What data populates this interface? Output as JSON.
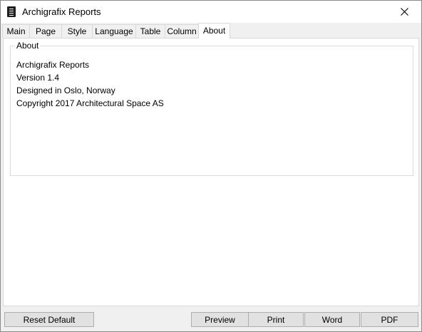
{
  "window": {
    "title": "Archigrafix Reports",
    "app_icon": "document-icon",
    "close_icon": "close-icon"
  },
  "tabs": [
    {
      "label": "Main",
      "active": false
    },
    {
      "label": "Page",
      "active": false
    },
    {
      "label": "Style",
      "active": false
    },
    {
      "label": "Language",
      "active": false
    },
    {
      "label": "Table",
      "active": false
    },
    {
      "label": "Column",
      "active": false
    },
    {
      "label": "About",
      "active": true
    }
  ],
  "about": {
    "group_title": "About",
    "lines": [
      "Archigrafix Reports",
      "Version 1.4",
      "Designed in Oslo, Norway",
      "Copyright 2017 Architectural Space AS"
    ]
  },
  "buttons": {
    "reset_default": "Reset Default",
    "preview": "Preview",
    "print": "Print",
    "word": "Word",
    "pdf": "PDF"
  }
}
